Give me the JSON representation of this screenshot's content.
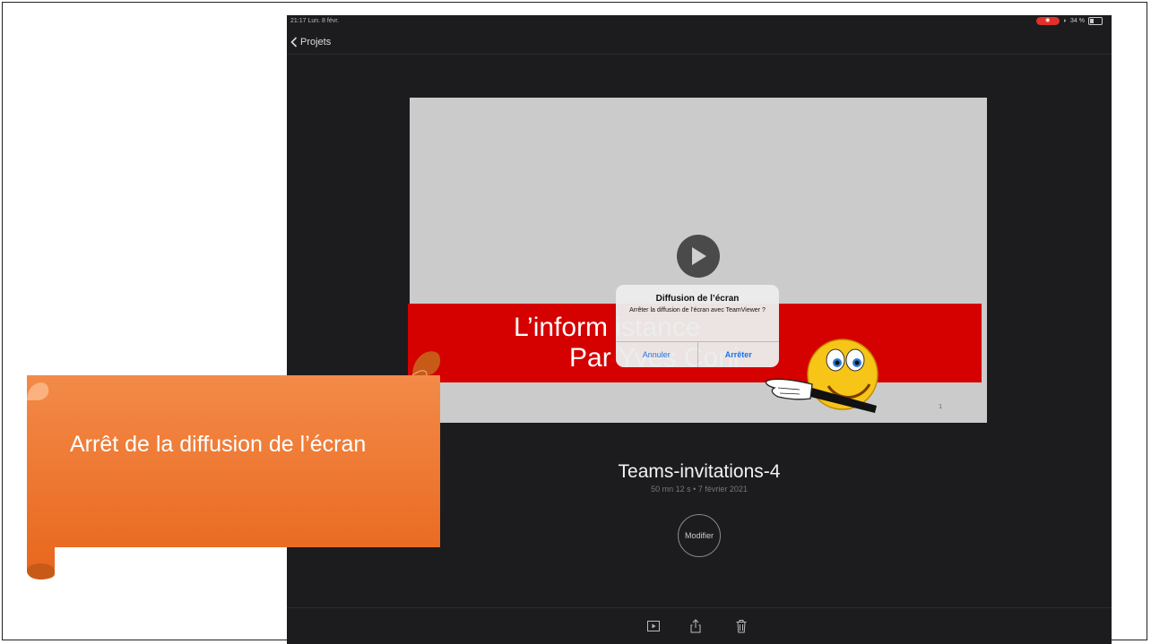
{
  "status_bar": {
    "time": "21:17 Lun. 8 févr.",
    "battery": "34 %"
  },
  "nav": {
    "back_label": "Projets"
  },
  "slide_preview": {
    "line1": "L’inform              istance",
    "line2": "Par Yves Coni",
    "page_number": "1"
  },
  "alert": {
    "title": "Diffusion de l’écran",
    "message": "Arrêter la diffusion de l’écran avec TeamViewer ?",
    "cancel_label": "Annuler",
    "stop_label": "Arrêter"
  },
  "video": {
    "title": "Teams-invitations-4",
    "meta": "50 mn 12 s • 7 février 2021",
    "edit_label": "Modifier"
  },
  "callout": {
    "text": "Arrêt de la diffusion de l’écran"
  },
  "icons": [
    "chevron-left-icon",
    "play-icon",
    "play-box-icon",
    "share-icon",
    "trash-icon",
    "pointing-hand-icon"
  ],
  "colors": {
    "red_band": "#d50000",
    "callout_orange": "#f0782c",
    "ios_blue": "#1a73e8",
    "ipad_bg": "#1c1c1e"
  }
}
